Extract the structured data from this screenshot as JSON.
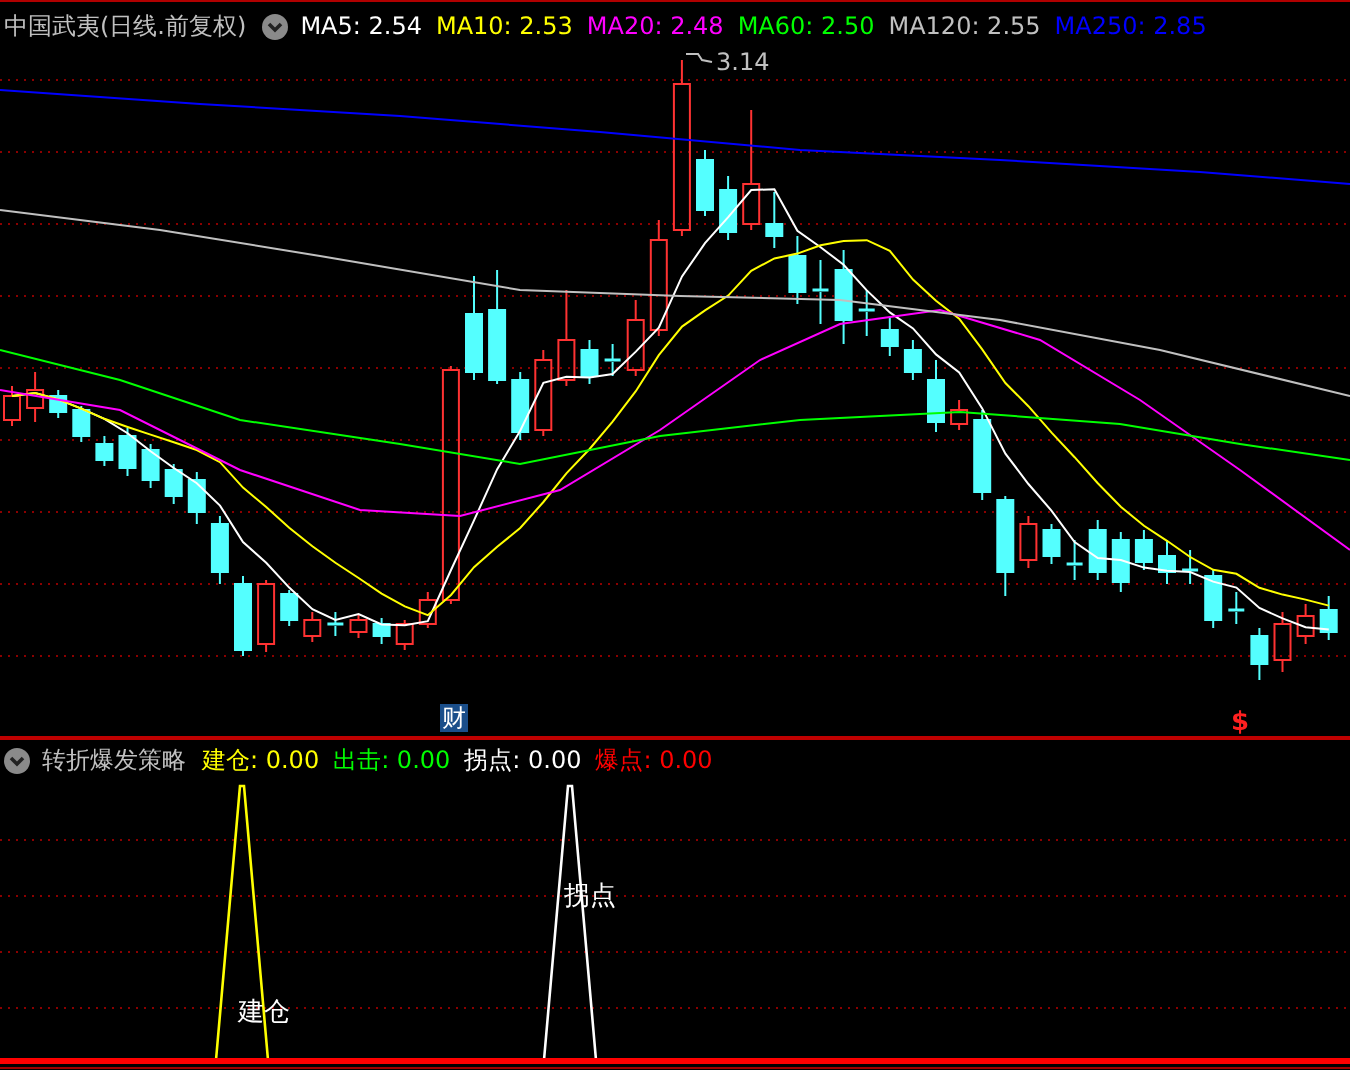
{
  "main_panel": {
    "title": "中国武夷(日线.前复权)",
    "indicators": [
      {
        "text": "MA5: 2.54",
        "color": "#ffffff"
      },
      {
        "text": "MA10: 2.53",
        "color": "#ffff00"
      },
      {
        "text": "MA20: 2.48",
        "color": "#ff00ff"
      },
      {
        "text": "MA60: 2.50",
        "color": "#00ff00"
      },
      {
        "text": "MA120: 2.55",
        "color": "#c0c0c0"
      },
      {
        "text": "MA250: 2.85",
        "color": "#0000ff"
      }
    ],
    "high_label": "3.14",
    "event_markers": [
      {
        "label": "财",
        "kind": "finance"
      },
      {
        "label": "$",
        "kind": "dividend"
      }
    ]
  },
  "indicator_panel": {
    "title": "转折爆发策略",
    "indicators": [
      {
        "text": "建仓: 0.00",
        "color": "#ffff00"
      },
      {
        "text": "出击: 0.00",
        "color": "#00ff00"
      },
      {
        "text": "拐点: 0.00",
        "color": "#ffffff"
      },
      {
        "text": "爆点: 0.00",
        "color": "#ff0000"
      }
    ],
    "signal_labels": [
      {
        "text": "建仓",
        "kind": "build"
      },
      {
        "text": "拐点",
        "kind": "turn"
      }
    ]
  }
}
